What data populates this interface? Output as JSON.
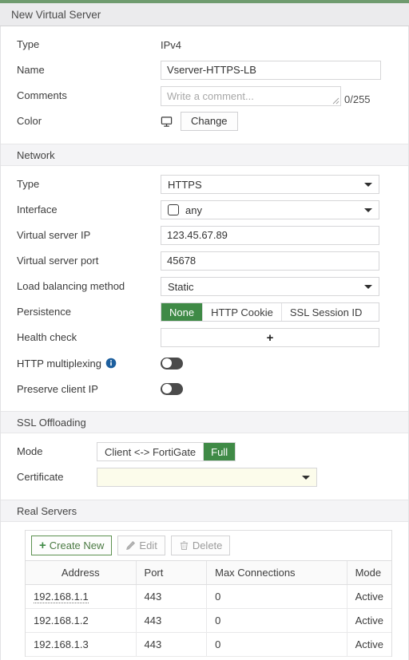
{
  "window": {
    "title": "New Virtual Server",
    "accent_color": "#6f9b6f"
  },
  "general": {
    "type_label": "Type",
    "type_value": "IPv4",
    "name_label": "Name",
    "name_value": "Vserver-HTTPS-LB",
    "comments_label": "Comments",
    "comments_value": "",
    "comments_placeholder": "Write a comment...",
    "comments_counter": "0/255",
    "color_label": "Color",
    "color_icon": "monitor-icon",
    "color_change_label": "Change"
  },
  "network": {
    "section_title": "Network",
    "type_label": "Type",
    "type_value": "HTTPS",
    "interface_label": "Interface",
    "interface_value": "any",
    "vip_label": "Virtual server IP",
    "vip_value": "123.45.67.89",
    "vport_label": "Virtual server port",
    "vport_value": "45678",
    "lb_label": "Load balancing method",
    "lb_value": "Static",
    "persistence_label": "Persistence",
    "persistence_options": [
      "None",
      "HTTP Cookie",
      "SSL Session ID"
    ],
    "persistence_selected": "None",
    "health_label": "Health check",
    "health_add_glyph": "+",
    "multiplex_label": "HTTP multiplexing",
    "multiplex_state": "off",
    "preserve_label": "Preserve client IP",
    "preserve_state": "off"
  },
  "ssl": {
    "section_title": "SSL Offloading",
    "mode_label": "Mode",
    "mode_options": [
      "Client <-> FortiGate",
      "Full"
    ],
    "mode_selected": "Full",
    "certificate_label": "Certificate",
    "certificate_value": ""
  },
  "real_servers": {
    "section_title": "Real Servers",
    "toolbar": {
      "create_label": "Create New",
      "edit_label": "Edit",
      "delete_label": "Delete"
    },
    "columns": [
      "Address",
      "Port",
      "Max Connections",
      "Mode"
    ],
    "rows": [
      {
        "address": "192.168.1.1",
        "port": "443",
        "max_connections": "0",
        "mode": "Active"
      },
      {
        "address": "192.168.1.2",
        "port": "443",
        "max_connections": "0",
        "mode": "Active"
      },
      {
        "address": "192.168.1.3",
        "port": "443",
        "max_connections": "0",
        "mode": "Active"
      }
    ]
  },
  "colors": {
    "selected_green": "#3f8a46",
    "create_border_green": "#5c9150",
    "info_blue": "#1d5f9e",
    "cert_field": "#fcfceb"
  }
}
